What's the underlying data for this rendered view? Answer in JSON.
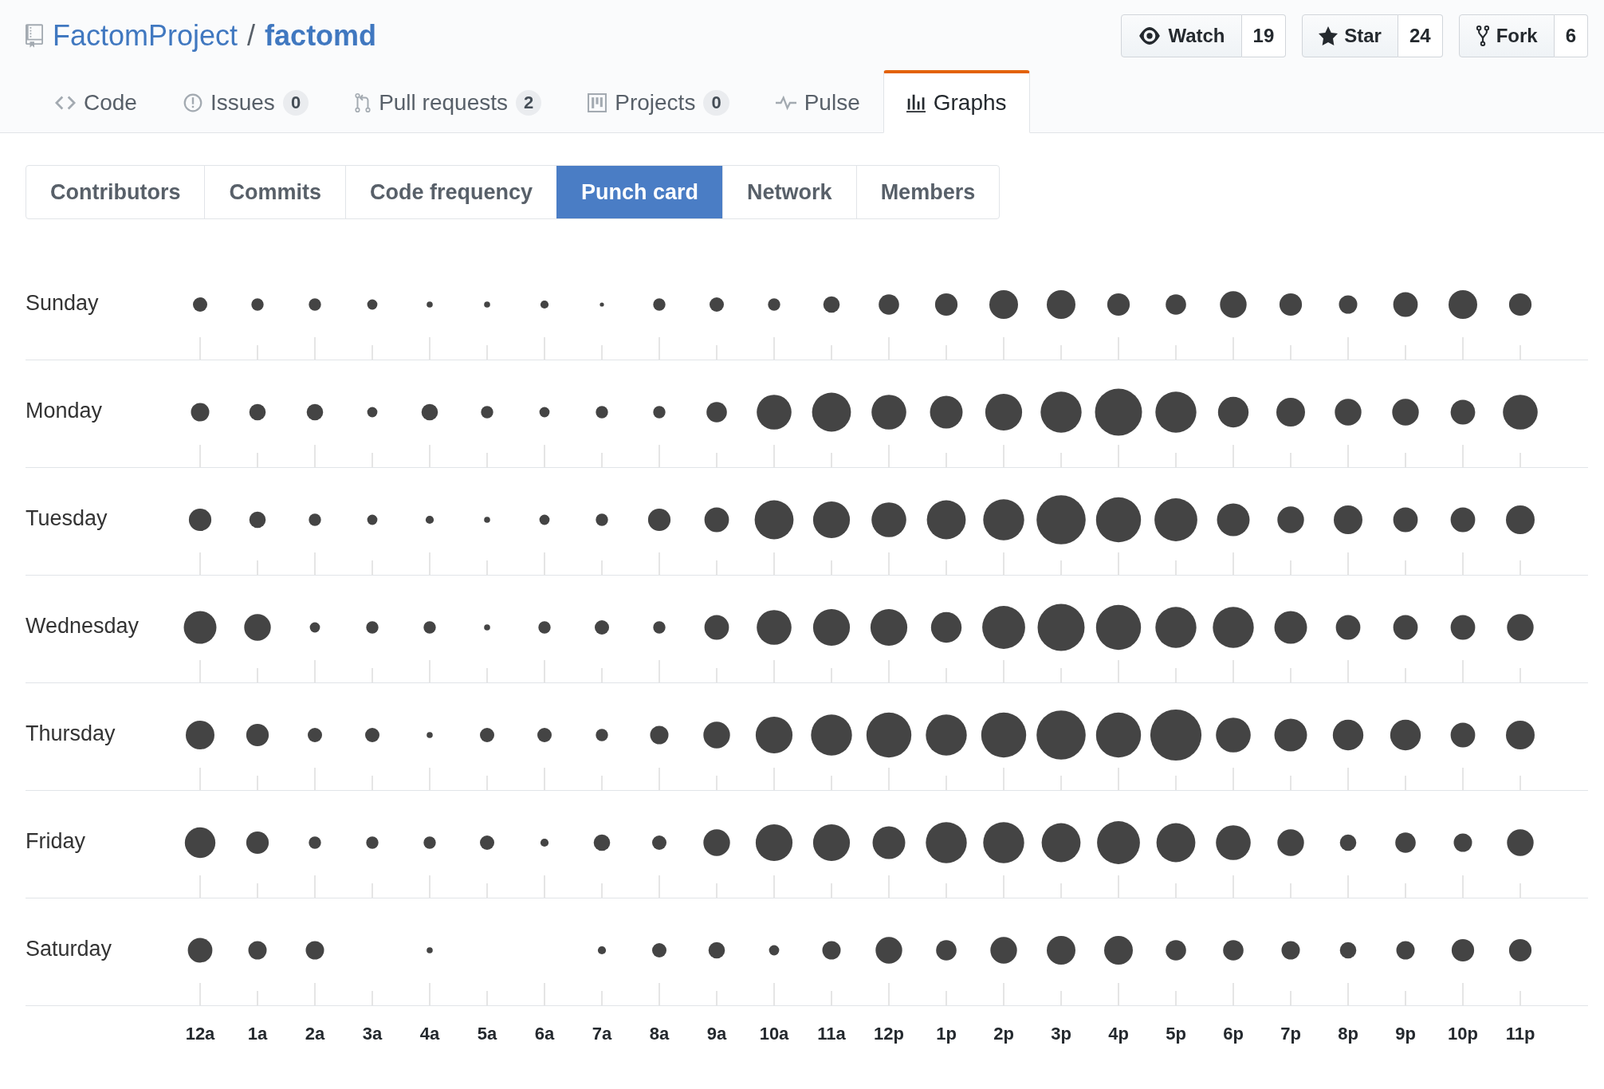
{
  "repo": {
    "owner": "FactomProject",
    "separator": "/",
    "name": "factomd"
  },
  "actions": [
    {
      "label": "Watch",
      "count": "19"
    },
    {
      "label": "Star",
      "count": "24"
    },
    {
      "label": "Fork",
      "count": "6"
    }
  ],
  "tabs": [
    {
      "label": "Code",
      "selected": false
    },
    {
      "label": "Issues",
      "count": "0",
      "selected": false
    },
    {
      "label": "Pull requests",
      "count": "2",
      "selected": false
    },
    {
      "label": "Projects",
      "count": "0",
      "selected": false
    },
    {
      "label": "Pulse",
      "selected": false
    },
    {
      "label": "Graphs",
      "selected": true
    }
  ],
  "subnav": [
    {
      "label": "Contributors",
      "selected": false
    },
    {
      "label": "Commits",
      "selected": false
    },
    {
      "label": "Code frequency",
      "selected": false
    },
    {
      "label": "Punch card",
      "selected": true
    },
    {
      "label": "Network",
      "selected": false
    },
    {
      "label": "Members",
      "selected": false
    }
  ],
  "punch_card": {
    "days": [
      "Sunday",
      "Monday",
      "Tuesday",
      "Wednesday",
      "Thursday",
      "Friday",
      "Saturday"
    ],
    "hours": [
      "12a",
      "1a",
      "2a",
      "3a",
      "4a",
      "5a",
      "6a",
      "7a",
      "8a",
      "9a",
      "10a",
      "11a",
      "12p",
      "1p",
      "2p",
      "3p",
      "4p",
      "5p",
      "6p",
      "7p",
      "8p",
      "9p",
      "10p",
      "11p"
    ]
  }
}
